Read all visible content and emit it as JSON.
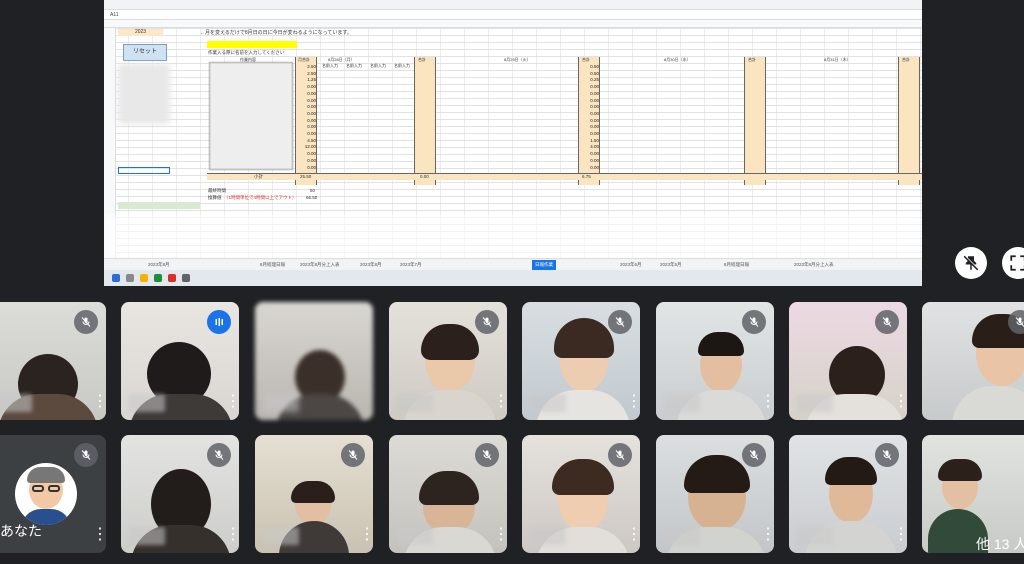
{
  "sheet": {
    "cell_ref": "A11",
    "header_note": "←月を変えるだけで8月日の日に今日が変わるようになっています。",
    "year_value": "2023",
    "reset_label": "リセット",
    "hint_label": "作業入る際に名前を入力してください",
    "task_header": "作業内容",
    "monthly_header": "月合計",
    "day_headers": [
      "8月28日（月）",
      "8月29日（火）",
      "8月30日（水）",
      "8月31日（木）"
    ],
    "name_col_label": "名前入力",
    "total_label": "合計",
    "subtotal_label": "小計",
    "monthly_values": [
      "2.50",
      "2.50",
      "1.25",
      "0.00",
      "0.00",
      "0.00",
      "0.00",
      "0.00",
      "0.00",
      "0.00",
      "0.00",
      "4.50",
      "12.00",
      "0.00",
      "0.00",
      "0.00"
    ],
    "monthly_total": "25.50",
    "day_total_values": [
      "0.50",
      "0.50",
      "0.25",
      "0.00",
      "0.00",
      "0.00",
      "0.00",
      "0.00",
      "0.00",
      "0.00",
      "0.00",
      "1.50",
      "4.00",
      "0.00",
      "0.00",
      "0.00"
    ],
    "day_total_sum": "6.75",
    "total_first": "0.00",
    "footer_label_1": "最終時間",
    "footer_value_1": "50",
    "footer_label_2": "換算値",
    "footer_red": "（1時間単位で4時間以上でアウト）",
    "footer_value_2": "66.50"
  },
  "sheet_tabs": [
    "2023年8月",
    "8月経理日報",
    "2023年8月分上入表",
    "2023年8月",
    "2023年7月",
    "2023年6月",
    "2023年5月",
    "8月経理日報",
    "2023年8月分上入表"
  ],
  "active_tab": "日報作業",
  "controls": {
    "unpin_icon": "unpin-icon",
    "fullscreen_icon": "fullscreen-icon"
  },
  "participants": {
    "self_label": "あなた",
    "more_label": "他 13 人"
  },
  "colors": {
    "background": "#202124",
    "accent": "#1a73e8",
    "tile": "#3c4043"
  }
}
